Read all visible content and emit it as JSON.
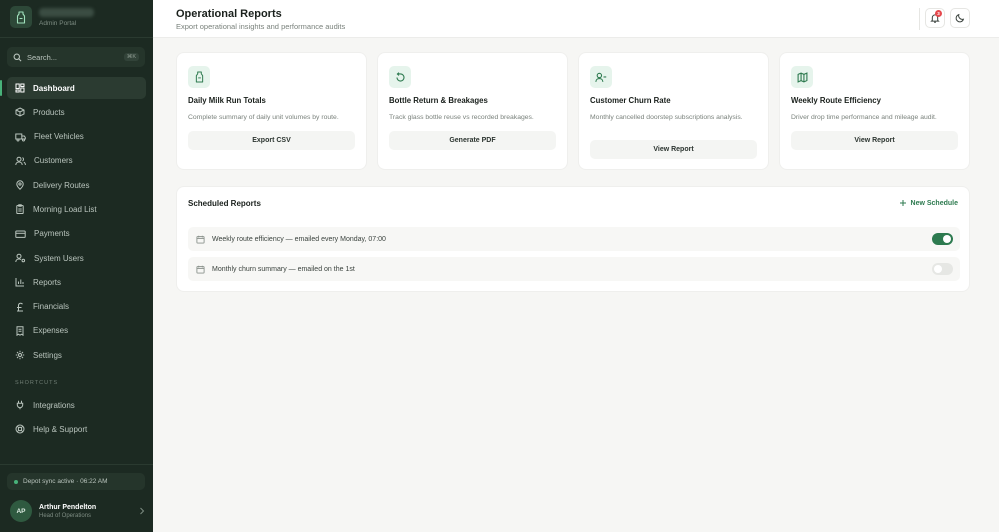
{
  "brand": {
    "subtitle": "Admin Portal"
  },
  "search": {
    "label": "Search...",
    "shortcut": "⌘K"
  },
  "nav": {
    "items": [
      {
        "label": "Dashboard",
        "icon": "dashboard-icon",
        "active": true
      },
      {
        "label": "Products",
        "icon": "box-icon"
      },
      {
        "label": "Fleet Vehicles",
        "icon": "truck-icon"
      },
      {
        "label": "Customers",
        "icon": "users-icon"
      },
      {
        "label": "Delivery Routes",
        "icon": "map-pin-icon"
      },
      {
        "label": "Morning Load List",
        "icon": "clipboard-icon"
      },
      {
        "label": "Payments",
        "icon": "credit-card-icon"
      },
      {
        "label": "System Users",
        "icon": "user-cog-icon"
      },
      {
        "label": "Reports",
        "icon": "bar-chart-icon"
      },
      {
        "label": "Financials",
        "icon": "pound-icon"
      },
      {
        "label": "Expenses",
        "icon": "receipt-icon"
      },
      {
        "label": "Settings",
        "icon": "gear-icon"
      }
    ]
  },
  "shortcuts": {
    "heading": "SHORTCUTS",
    "items": [
      {
        "label": "Integrations",
        "icon": "plug-icon"
      },
      {
        "label": "Help & Support",
        "icon": "lifebuoy-icon"
      }
    ]
  },
  "status": {
    "sync": "Depot sync active · 06:22 AM"
  },
  "user": {
    "initials": "AP",
    "name": "Arthur Pendelton",
    "role": "Head of Operations"
  },
  "header": {
    "title": "Operational Reports",
    "subtitle": "Export operational insights and performance audits",
    "notification_count": "3"
  },
  "cards": [
    {
      "title": "Daily Milk Run Totals",
      "description": "Complete summary of daily unit volumes by route.",
      "action": "Export CSV",
      "icon": "milk-bottle-icon"
    },
    {
      "title": "Bottle Return & Breakages",
      "description": "Track glass bottle reuse vs recorded breakages.",
      "action": "Generate PDF",
      "icon": "refresh-icon"
    },
    {
      "title": "Customer Churn Rate",
      "description": "Monthly cancelled doorstep subscriptions analysis.",
      "action": "View Report",
      "icon": "user-minus-icon"
    },
    {
      "title": "Weekly Route Efficiency",
      "description": "Driver drop time performance and mileage audit.",
      "action": "View Report",
      "icon": "map-icon"
    }
  ],
  "scheduled": {
    "title": "Scheduled Reports",
    "new_label": "New Schedule",
    "rows": [
      {
        "text": "Weekly route efficiency — emailed every Monday, 07:00",
        "enabled": true
      },
      {
        "text": "Monthly churn summary — emailed on the 1st",
        "enabled": false
      }
    ]
  },
  "colors": {
    "sidebar": "#1c2a22",
    "accent": "#2d7a4f",
    "active_indicator": "#48b27a",
    "badge": "#e5484d"
  }
}
